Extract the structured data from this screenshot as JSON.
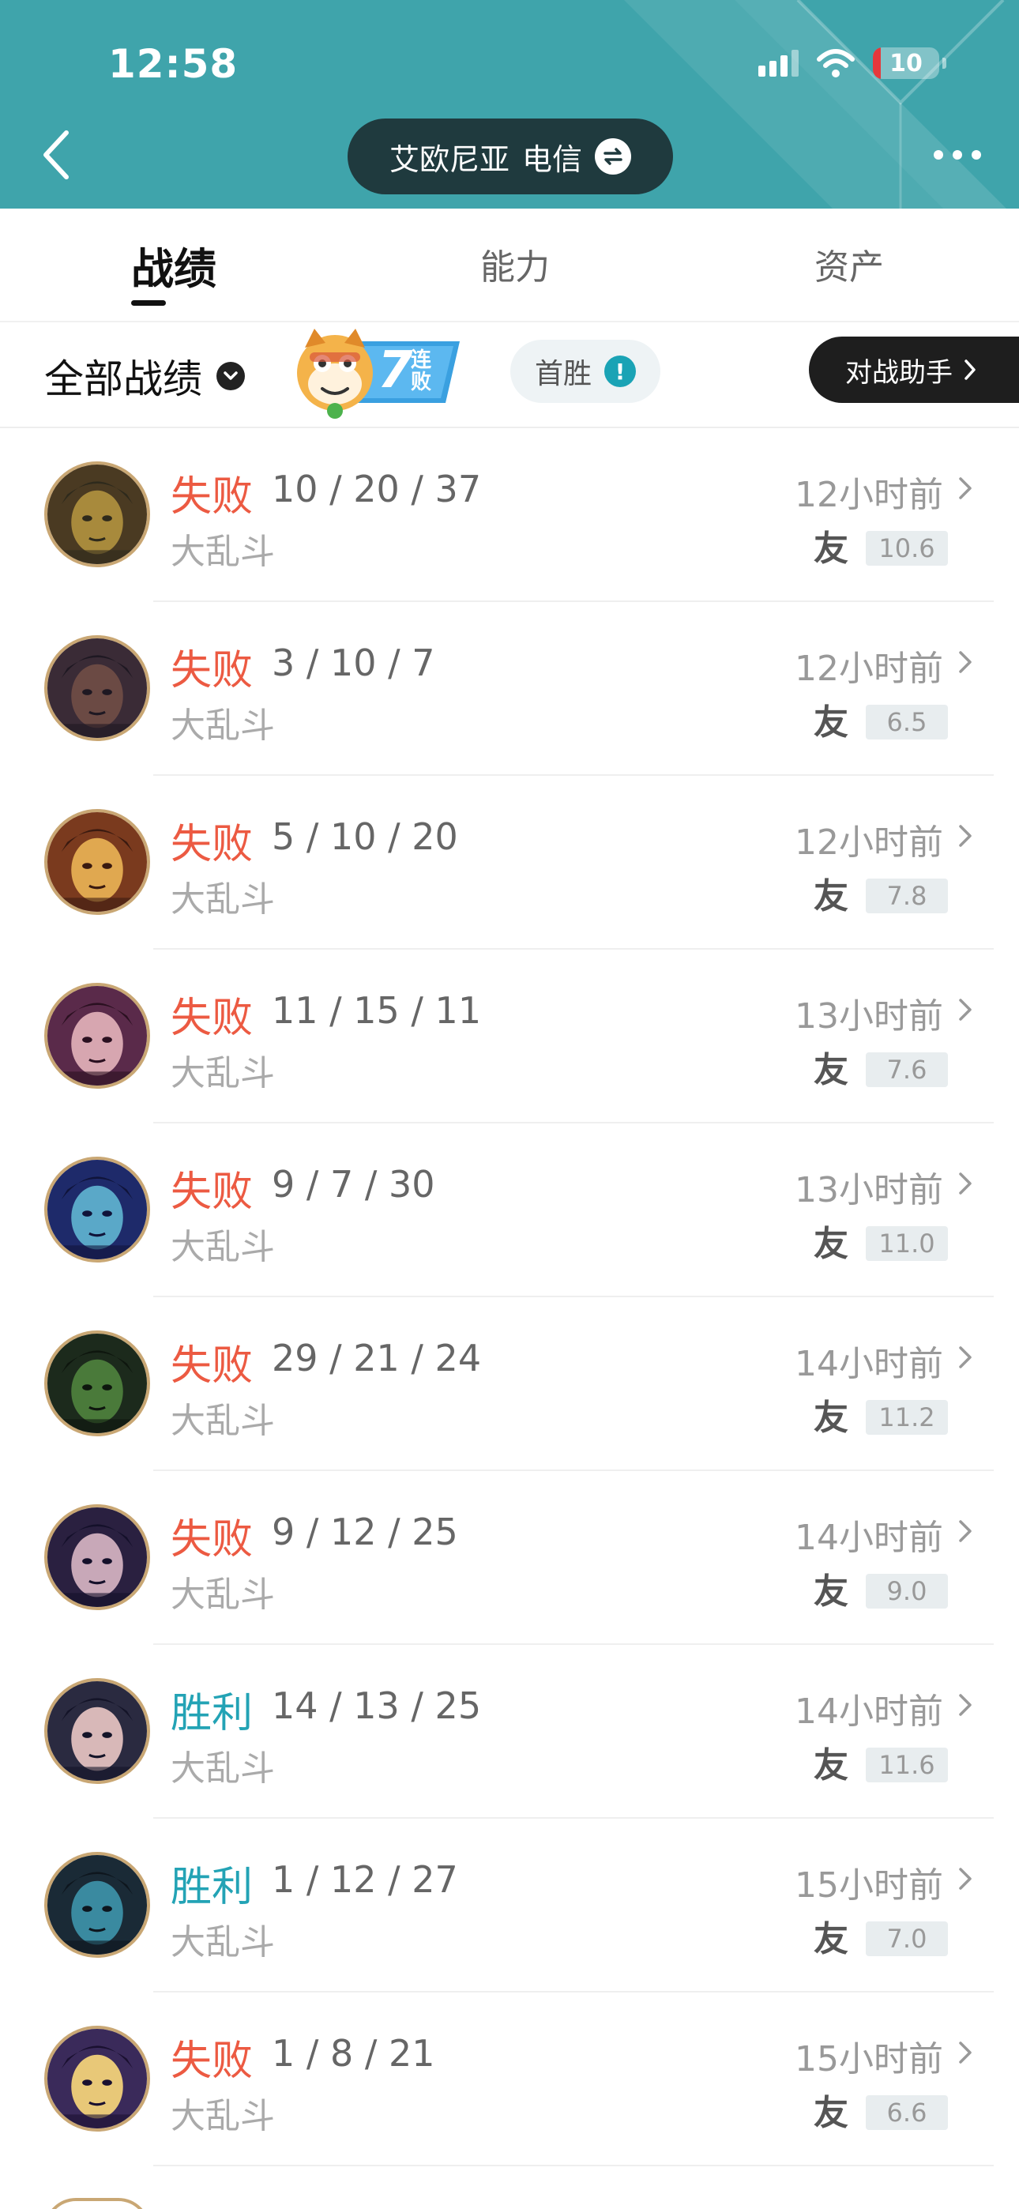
{
  "status_bar": {
    "time": "12:58",
    "battery": "10"
  },
  "header": {
    "server_name": "艾欧尼亚",
    "carrier": "电信"
  },
  "tabs": [
    {
      "label": "战绩",
      "active": true
    },
    {
      "label": "能力",
      "active": false
    },
    {
      "label": "资产",
      "active": false
    }
  ],
  "filter": {
    "all_records_label": "全部战绩",
    "streak": {
      "count": "7",
      "label": "连败"
    },
    "first_win_label": "首胜",
    "first_win_info": "!",
    "assistant_label": "对战助手"
  },
  "matches": [
    {
      "result": "失败",
      "outcome": "lose",
      "kda": "10 / 20 / 37",
      "mode": "大乱斗",
      "time": "12小时前",
      "friend": "友",
      "score": "10.6",
      "avatar_palette": [
        "#4a3a22",
        "#a88a3c",
        "#2e2a1c"
      ]
    },
    {
      "result": "失败",
      "outcome": "lose",
      "kda": "3 / 10 / 7",
      "mode": "大乱斗",
      "time": "12小时前",
      "friend": "友",
      "score": "6.5",
      "avatar_palette": [
        "#3a2b36",
        "#6b4a44",
        "#1e1822"
      ]
    },
    {
      "result": "失败",
      "outcome": "lose",
      "kda": "5 / 10 / 20",
      "mode": "大乱斗",
      "time": "12小时前",
      "friend": "友",
      "score": "7.8",
      "avatar_palette": [
        "#7a3a1e",
        "#e0a850",
        "#3a1a10"
      ]
    },
    {
      "result": "失败",
      "outcome": "lose",
      "kda": "11 / 15 / 11",
      "mode": "大乱斗",
      "time": "13小时前",
      "friend": "友",
      "score": "7.6",
      "avatar_palette": [
        "#5a2a4a",
        "#d7a6b0",
        "#2a1020"
      ]
    },
    {
      "result": "失败",
      "outcome": "lose",
      "kda": "9 / 7 / 30",
      "mode": "大乱斗",
      "time": "13小时前",
      "friend": "友",
      "score": "11.0",
      "avatar_palette": [
        "#1e2a6a",
        "#5aa8c8",
        "#10143a"
      ]
    },
    {
      "result": "失败",
      "outcome": "lose",
      "kda": "29 / 21 / 24",
      "mode": "大乱斗",
      "time": "14小时前",
      "friend": "友",
      "score": "11.2",
      "avatar_palette": [
        "#1c2a1c",
        "#4a7a3a",
        "#0e160e"
      ]
    },
    {
      "result": "失败",
      "outcome": "lose",
      "kda": "9 / 12 / 25",
      "mode": "大乱斗",
      "time": "14小时前",
      "friend": "友",
      "score": "9.0",
      "avatar_palette": [
        "#2a2040",
        "#c8a8b8",
        "#14102a"
      ]
    },
    {
      "result": "胜利",
      "outcome": "win",
      "kda": "14 / 13 / 25",
      "mode": "大乱斗",
      "time": "14小时前",
      "friend": "友",
      "score": "11.6",
      "avatar_palette": [
        "#2a2a40",
        "#d8b8b8",
        "#141428"
      ]
    },
    {
      "result": "胜利",
      "outcome": "win",
      "kda": "1 / 12 / 27",
      "mode": "大乱斗",
      "time": "15小时前",
      "friend": "友",
      "score": "7.0",
      "avatar_palette": [
        "#1a2a36",
        "#3a8aa0",
        "#0e161e"
      ]
    },
    {
      "result": "失败",
      "outcome": "lose",
      "kda": "1 / 8 / 21",
      "mode": "大乱斗",
      "time": "15小时前",
      "friend": "友",
      "score": "6.6",
      "avatar_palette": [
        "#3a2a5a",
        "#e8c878",
        "#1a1030"
      ]
    }
  ],
  "colors": {
    "header": "#3fa4ab",
    "lose": "#ec5a42",
    "win": "#23a3b5",
    "avatar_border": "#c9a774"
  }
}
